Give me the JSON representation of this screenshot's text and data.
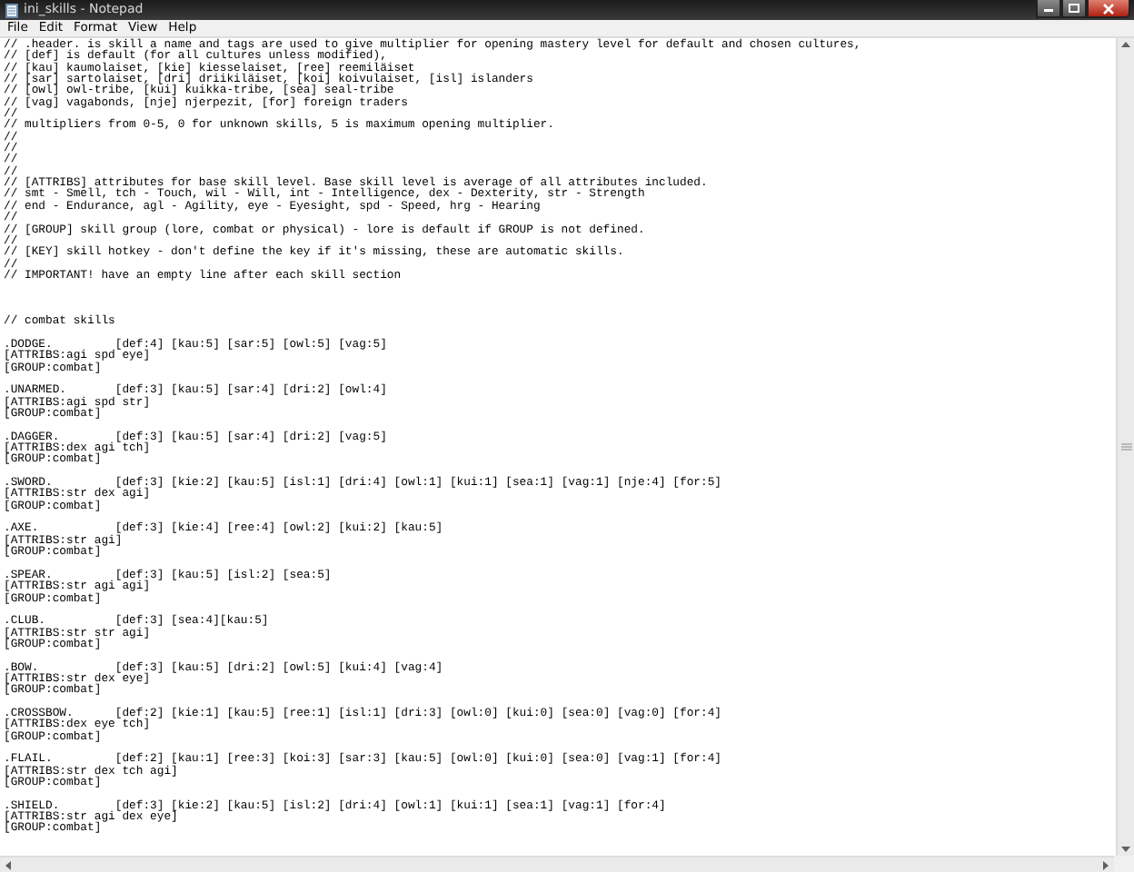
{
  "window": {
    "title": "ini_skills - Notepad"
  },
  "menu": [
    "File",
    "Edit",
    "Format",
    "View",
    "Help"
  ],
  "document": {
    "text": "// .header. is skill a name and tags are used to give multiplier for opening mastery level for default and chosen cultures,\n// [def] is default (for all cultures unless modified),\n// [kau] kaumolaiset, [kie] kiesselaiset, [ree] reemiläiset\n// [sar] sartolaiset, [dri] driikiläiset, [koi] koivulaiset, [isl] islanders\n// [owl] owl-tribe, [kui] kuikka-tribe, [sea] seal-tribe\n// [vag] vagabonds, [nje] njerpezit, [for] foreign traders\n//\n// multipliers from 0-5, 0 for unknown skills, 5 is maximum opening multiplier.\n//\n//\n//\n//\n// [ATTRIBS] attributes for base skill level. Base skill level is average of all attributes included.\n// smt - Smell, tch - Touch, wil - Will, int - Intelligence, dex - Dexterity, str - Strength\n// end - Endurance, agl - Agility, eye - Eyesight, spd - Speed, hrg - Hearing\n//\n// [GROUP] skill group (lore, combat or physical) - lore is default if GROUP is not defined.\n//\n// [KEY] skill hotkey - don't define the key if it's missing, these are automatic skills.\n//\n// IMPORTANT! have an empty line after each skill section\n\n\n\n// combat skills\n\n.DODGE.\t\t[def:4] [kau:5] [sar:5] [owl:5] [vag:5]\n[ATTRIBS:agi spd eye]\n[GROUP:combat]\n\n.UNARMED.\t[def:3] [kau:5] [sar:4] [dri:2] [owl:4]\n[ATTRIBS:agi spd str]\n[GROUP:combat]\n\n.DAGGER.\t[def:3] [kau:5] [sar:4] [dri:2] [vag:5]\n[ATTRIBS:dex agi tch]\n[GROUP:combat]\n\n.SWORD.\t\t[def:3] [kie:2] [kau:5] [isl:1] [dri:4] [owl:1] [kui:1] [sea:1] [vag:1] [nje:4] [for:5]\n[ATTRIBS:str dex agi]\n[GROUP:combat]\n\n.AXE.\t\t[def:3] [kie:4] [ree:4] [owl:2] [kui:2] [kau:5]\n[ATTRIBS:str agi]\n[GROUP:combat]\n\n.SPEAR.\t\t[def:3] [kau:5] [isl:2] [sea:5]\n[ATTRIBS:str agi agi]\n[GROUP:combat]\n\n.CLUB.\t\t[def:3] [sea:4][kau:5]\n[ATTRIBS:str str agi]\n[GROUP:combat]\n\n.BOW.\t\t[def:3] [kau:5] [dri:2] [owl:5] [kui:4] [vag:4]\n[ATTRIBS:str dex eye]\n[GROUP:combat]\n\n.CROSSBOW.\t[def:2] [kie:1] [kau:5] [ree:1] [isl:1] [dri:3] [owl:0] [kui:0] [sea:0] [vag:0] [for:4]\n[ATTRIBS:dex eye tch]\n[GROUP:combat]\n\n.FLAIL.\t\t[def:2] [kau:1] [ree:3] [koi:3] [sar:3] [kau:5] [owl:0] [kui:0] [sea:0] [vag:1] [for:4]\n[ATTRIBS:str dex tch agi]\n[GROUP:combat]\n\n.SHIELD.\t[def:3] [kie:2] [kau:5] [isl:2] [dri:4] [owl:1] [kui:1] [sea:1] [vag:1] [for:4]\n[ATTRIBS:str agi dex eye]\n[GROUP:combat]"
  }
}
